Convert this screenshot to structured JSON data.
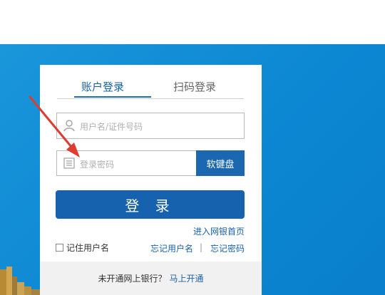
{
  "colors": {
    "banner": "#0c87d2",
    "primary": "#1762af",
    "link": "#1b62a8",
    "footer_bg": "#f1f1f1"
  },
  "tabs": [
    {
      "label": "账户登录",
      "active": true
    },
    {
      "label": "扫码登录",
      "active": false
    }
  ],
  "username": {
    "placeholder": "用户名/证件号码",
    "icon": "user-icon"
  },
  "password": {
    "placeholder": "登录密码",
    "icon": "keypad-icon"
  },
  "keyboard_button": "软键盘",
  "login_button": "登 录",
  "enter_bank_link": "进入网银首页",
  "remember_label": "记住用户名",
  "forgot_username": "忘记用户名",
  "separator": "|",
  "forgot_password": "忘记密码",
  "footer": {
    "text": "未开通网上银行？",
    "link": "马上开通"
  }
}
